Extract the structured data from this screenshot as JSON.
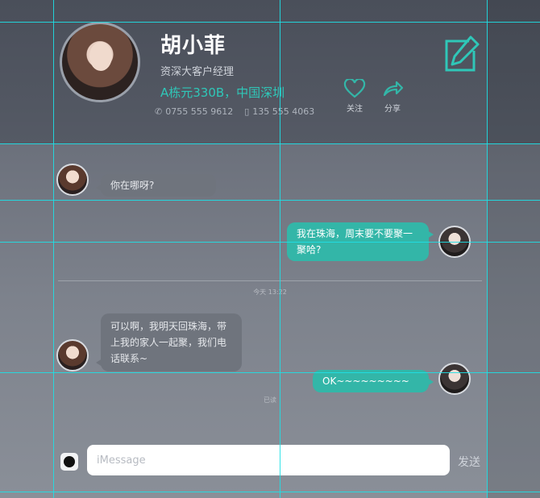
{
  "profile": {
    "name": "胡小菲",
    "title": "资深大客户经理",
    "address": "A栋元330B，中国深圳",
    "phone": "0755 555 9612",
    "mobile": "135 555 4063"
  },
  "actions": {
    "follow_label": "关注",
    "share_label": "分享"
  },
  "colors": {
    "accent": "#33b6a8",
    "address": "#2fc7b8",
    "guide": "#1ee0e6"
  },
  "messages": [
    {
      "direction": "in",
      "text": "你在哪呀?"
    },
    {
      "direction": "out",
      "text": "我在珠海，周末要不要聚一聚哈?"
    },
    {
      "direction": "in",
      "text": "可以啊，我明天回珠海，带上我的家人一起聚，我们电话联系~"
    },
    {
      "direction": "out",
      "text": "OK~~~~~~~~~"
    }
  ],
  "timestamps": {
    "divider": "今天 13:22",
    "read": "已读"
  },
  "composer": {
    "placeholder": "iMessage",
    "send_label": "发送"
  },
  "icons": {
    "edit": "edit-icon",
    "follow": "heart-icon",
    "share": "share-icon",
    "phone": "phone-icon",
    "mobile": "mobile-icon",
    "camera": "camera-icon"
  }
}
